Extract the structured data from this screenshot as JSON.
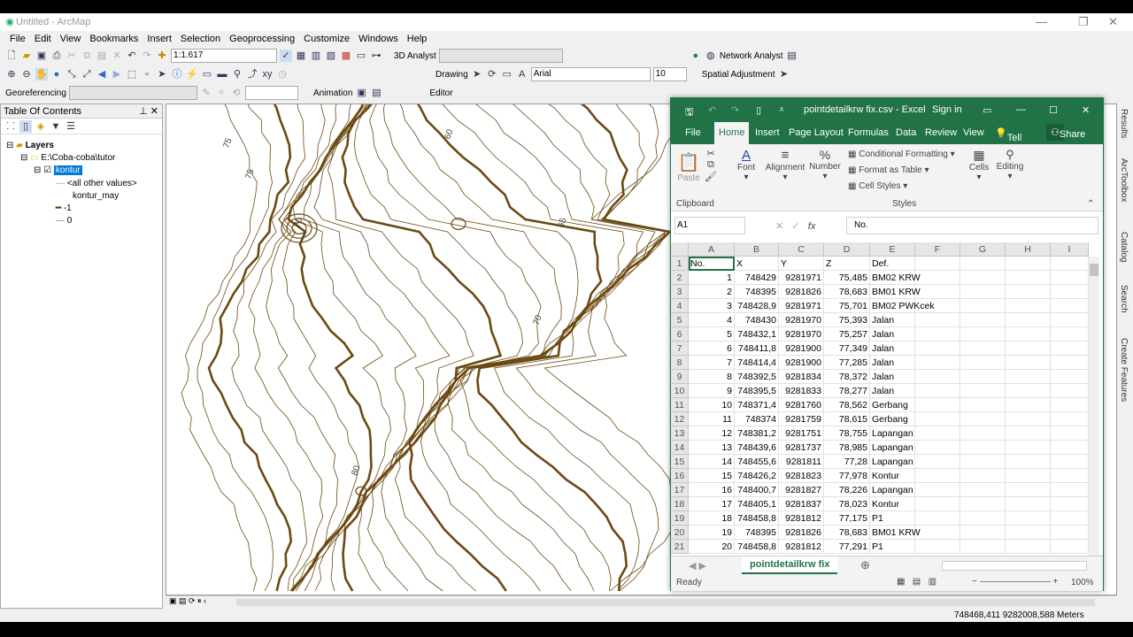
{
  "arcmap": {
    "title": "Untitled - ArcMap",
    "menu": [
      "File",
      "Edit",
      "View",
      "Bookmarks",
      "Insert",
      "Selection",
      "Geoprocessing",
      "Customize",
      "Windows",
      "Help"
    ],
    "scale": "1:1.617",
    "toolbars": {
      "analyst3d": "3D Analyst",
      "network": "Network Analyst",
      "drawing": "Drawing",
      "font": "Arial",
      "font_size": "10",
      "spatial_adj": "Spatial Adjustment",
      "georef": "Georeferencing",
      "animation": "Animation",
      "editor": "Editor"
    },
    "toc": {
      "title": "Table Of Contents",
      "items": [
        "Layers",
        "E:\\Coba-coba\\tutor",
        "kontur",
        "<all other values>",
        "kontur_may",
        "-1",
        "0"
      ]
    },
    "map": {
      "contour_labels": [
        "75",
        "60",
        "65",
        "70",
        "75",
        "80",
        "70"
      ],
      "line_color": "#6b4a12"
    },
    "right_tabs": [
      "Results",
      "ArcToolbox",
      "Catalog",
      "Search",
      "Create Features"
    ],
    "coordinates": "748468,411  9282008,588 Meters"
  },
  "excel": {
    "title": "pointdetailkrw fix.csv  -  Excel",
    "sign_in": "Sign in",
    "tabs": [
      "File",
      "Home",
      "Insert",
      "Page Layout",
      "Formulas",
      "Data",
      "Review",
      "View",
      "Tell me",
      "Share"
    ],
    "ribbon": {
      "paste": "Paste",
      "clipboard": "Clipboard",
      "font": "Font",
      "alignment": "Alignment",
      "number": "Number",
      "cond_format": "Conditional Formatting",
      "format_table": "Format as Table",
      "cell_styles": "Cell Styles",
      "styles": "Styles",
      "cells": "Cells",
      "editing": "Editing"
    },
    "name_box": "A1",
    "formula": "No.",
    "columns": [
      "A",
      "B",
      "C",
      "D",
      "E",
      "F",
      "G",
      "H",
      "I"
    ],
    "rows": [
      [
        "No.",
        "X",
        "Y",
        "Z",
        "Def."
      ],
      [
        "1",
        "748429",
        "9281971",
        "75,485",
        "BM02 KRW"
      ],
      [
        "2",
        "748395",
        "9281826",
        "78,683",
        "BM01 KRW"
      ],
      [
        "3",
        "748428,9",
        "9281971",
        "75,701",
        "BM02 PWKcek"
      ],
      [
        "4",
        "748430",
        "9281970",
        "75,393",
        "Jalan"
      ],
      [
        "5",
        "748432,1",
        "9281970",
        "75,257",
        "Jalan"
      ],
      [
        "6",
        "748411,8",
        "9281900",
        "77,349",
        "Jalan"
      ],
      [
        "7",
        "748414,4",
        "9281900",
        "77,285",
        "Jalan"
      ],
      [
        "8",
        "748392,5",
        "9281834",
        "78,372",
        "Jalan"
      ],
      [
        "9",
        "748395,5",
        "9281833",
        "78,277",
        "Jalan"
      ],
      [
        "10",
        "748371,4",
        "9281760",
        "78,562",
        "Gerbang"
      ],
      [
        "11",
        "748374",
        "9281759",
        "78,615",
        "Gerbang"
      ],
      [
        "12",
        "748381,2",
        "9281751",
        "78,755",
        "Lapangan"
      ],
      [
        "13",
        "748439,6",
        "9281737",
        "78,985",
        "Lapangan"
      ],
      [
        "14",
        "748455,6",
        "9281811",
        "77,28",
        "Lapangan"
      ],
      [
        "15",
        "748426,2",
        "9281823",
        "77,978",
        "Kontur"
      ],
      [
        "16",
        "748400,7",
        "9281827",
        "78,226",
        "Lapangan"
      ],
      [
        "17",
        "748405,1",
        "9281837",
        "78,023",
        "Kontur"
      ],
      [
        "18",
        "748458,8",
        "9281812",
        "77,175",
        "P1"
      ],
      [
        "19",
        "748395",
        "9281826",
        "78,683",
        "BM01 KRW"
      ],
      [
        "20",
        "748458,8",
        "9281812",
        "77,291",
        "P1"
      ]
    ],
    "sheet_tab": "pointdetailkrw fix",
    "status": "Ready",
    "zoom": "100%",
    "accent": "#217346"
  }
}
